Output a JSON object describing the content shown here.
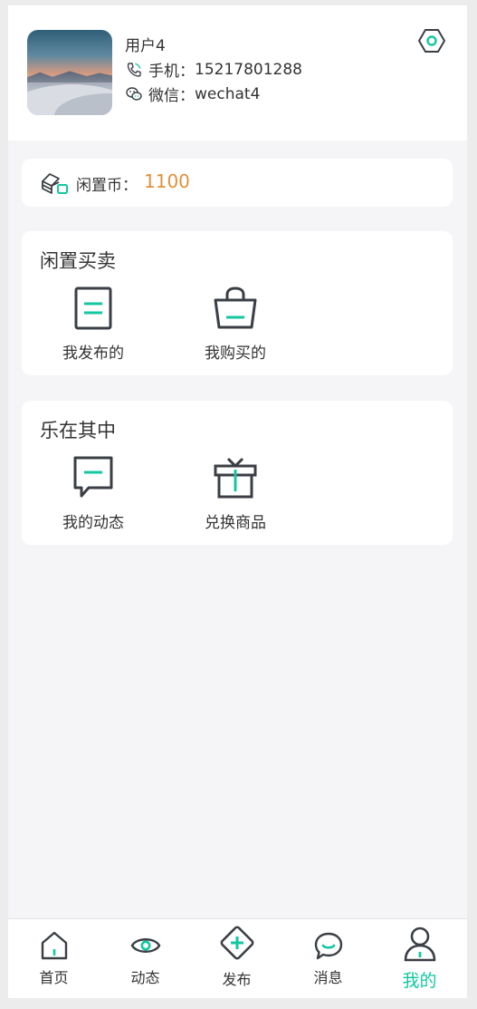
{
  "profile": {
    "username": "用户4",
    "phone_label": "手机：",
    "phone": "15217801288",
    "wechat_label": "微信：",
    "wechat": "wechat4",
    "settings_icon": "settings-hexagon-icon"
  },
  "coins": {
    "label": "闲置币：",
    "value": "1100",
    "value_color": "#e0913a"
  },
  "trade_section": {
    "title": "闲置买卖",
    "items": [
      {
        "label": "我发布的",
        "icon": "document-icon"
      },
      {
        "label": "我购买的",
        "icon": "shopping-bag-icon"
      }
    ]
  },
  "fun_section": {
    "title": "乐在其中",
    "items": [
      {
        "label": "我的动态",
        "icon": "message-square-icon"
      },
      {
        "label": "兑换商品",
        "icon": "gift-icon"
      }
    ]
  },
  "tabbar": {
    "items": [
      {
        "label": "首页",
        "icon": "home-icon"
      },
      {
        "label": "动态",
        "icon": "eye-icon"
      },
      {
        "label": "发布",
        "icon": "plus-diamond-icon"
      },
      {
        "label": "消息",
        "icon": "chat-bubble-icon"
      },
      {
        "label": "我的",
        "icon": "user-icon",
        "active": true
      }
    ],
    "active_color": "#14c7a0"
  },
  "colors": {
    "accent": "#14c7a0",
    "icon_stroke": "#3a3f45"
  }
}
